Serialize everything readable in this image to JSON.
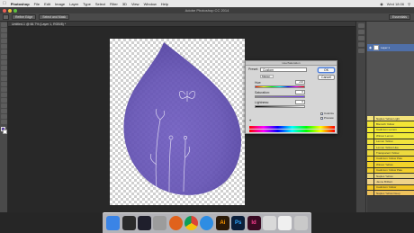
{
  "menubar": {
    "app_name": "Photoshop",
    "items": [
      "File",
      "Edit",
      "Image",
      "Layer",
      "Type",
      "Select",
      "Filter",
      "3D",
      "View",
      "Window",
      "Help"
    ],
    "status": "Wed 18:06"
  },
  "window": {
    "title": "Adobe Photoshop CC 2014"
  },
  "options": {
    "btn1": "Refine Edge",
    "btn2": "Select and Mask",
    "workspace": "Essentials"
  },
  "doc_tab": "Untitled-1 @ 66.7% (Layer 1, RGB/8) *",
  "dialog": {
    "title": "Hue/Saturation",
    "preset_label": "Preset:",
    "preset_value": "Custom",
    "ok_label": "OK",
    "cancel_label": "Cancel",
    "master": "Master",
    "hue_label": "Hue:",
    "hue_value": "+94",
    "saturation_label": "Saturation:",
    "saturation_value": "0",
    "lightness_label": "Lightness:",
    "lightness_value": "0",
    "colorize_label": "Colorize",
    "preview_label": "Preview",
    "colorize_checked": true,
    "preview_checked": true
  },
  "layers": {
    "layer_name": "Layer 1"
  },
  "swatches": [
    {
      "name": "Naples Yellow Light",
      "color": "#f3e27a"
    },
    {
      "name": "Bismuth Yellow",
      "color": "#f2e536"
    },
    {
      "name": "Cadmium Lemon",
      "color": "#f4ec2f"
    },
    {
      "name": "Winsor Lemon",
      "color": "#f0ea3a"
    },
    {
      "name": "Lemon Yellow",
      "color": "#f1e43c"
    },
    {
      "name": "Lemon Yellow Hue",
      "color": "#eee048"
    },
    {
      "name": "Transparent Yellow",
      "color": "#ecd93e"
    },
    {
      "name": "Cadmium Yellow Pale",
      "color": "#f3d62c"
    },
    {
      "name": "Winsor Yellow",
      "color": "#f2d32b"
    },
    {
      "name": "Cadmium Yellow Pale",
      "color": "#f2cf2a"
    },
    {
      "name": "Naples Yellow",
      "color": "#e9d476"
    },
    {
      "name": "Jaune Brillant",
      "color": "#efd38a"
    },
    {
      "name": "Cadmium Yellow",
      "color": "#f2c624"
    },
    {
      "name": "Naples Yellow Deep",
      "color": "#eec25c"
    }
  ],
  "colors": {
    "purple": "#6b58b8",
    "accent": "#4f6fa8"
  },
  "dock": [
    {
      "icon": "finder-icon",
      "color": "#3a84e6",
      "label": ""
    },
    {
      "icon": "dashboard-icon",
      "color": "#2b2b2b",
      "label": ""
    },
    {
      "icon": "mission-control-icon",
      "color": "#1f1f2c",
      "label": ""
    },
    {
      "icon": "launchpad-icon",
      "color": "#9c9c9c",
      "label": ""
    },
    {
      "icon": "firefox-icon",
      "color": "#e0621c",
      "label": ""
    },
    {
      "icon": "chrome-icon",
      "color": "#ffffff",
      "label": ""
    },
    {
      "icon": "safari-icon",
      "color": "#2e8de3",
      "label": ""
    },
    {
      "icon": "illustrator-icon",
      "color": "#2b1a08",
      "label": "Ai"
    },
    {
      "icon": "photoshop-icon",
      "color": "#0b1f3a",
      "label": "Ps"
    },
    {
      "icon": "indesign-icon",
      "color": "#3a0b23",
      "label": "Id"
    },
    {
      "icon": "preview-icon",
      "color": "#d9d9d9",
      "label": ""
    },
    {
      "icon": "itunes-icon",
      "color": "#f0f0f0",
      "label": ""
    },
    {
      "icon": "trash-icon",
      "color": "#c9c9c9",
      "label": ""
    }
  ]
}
